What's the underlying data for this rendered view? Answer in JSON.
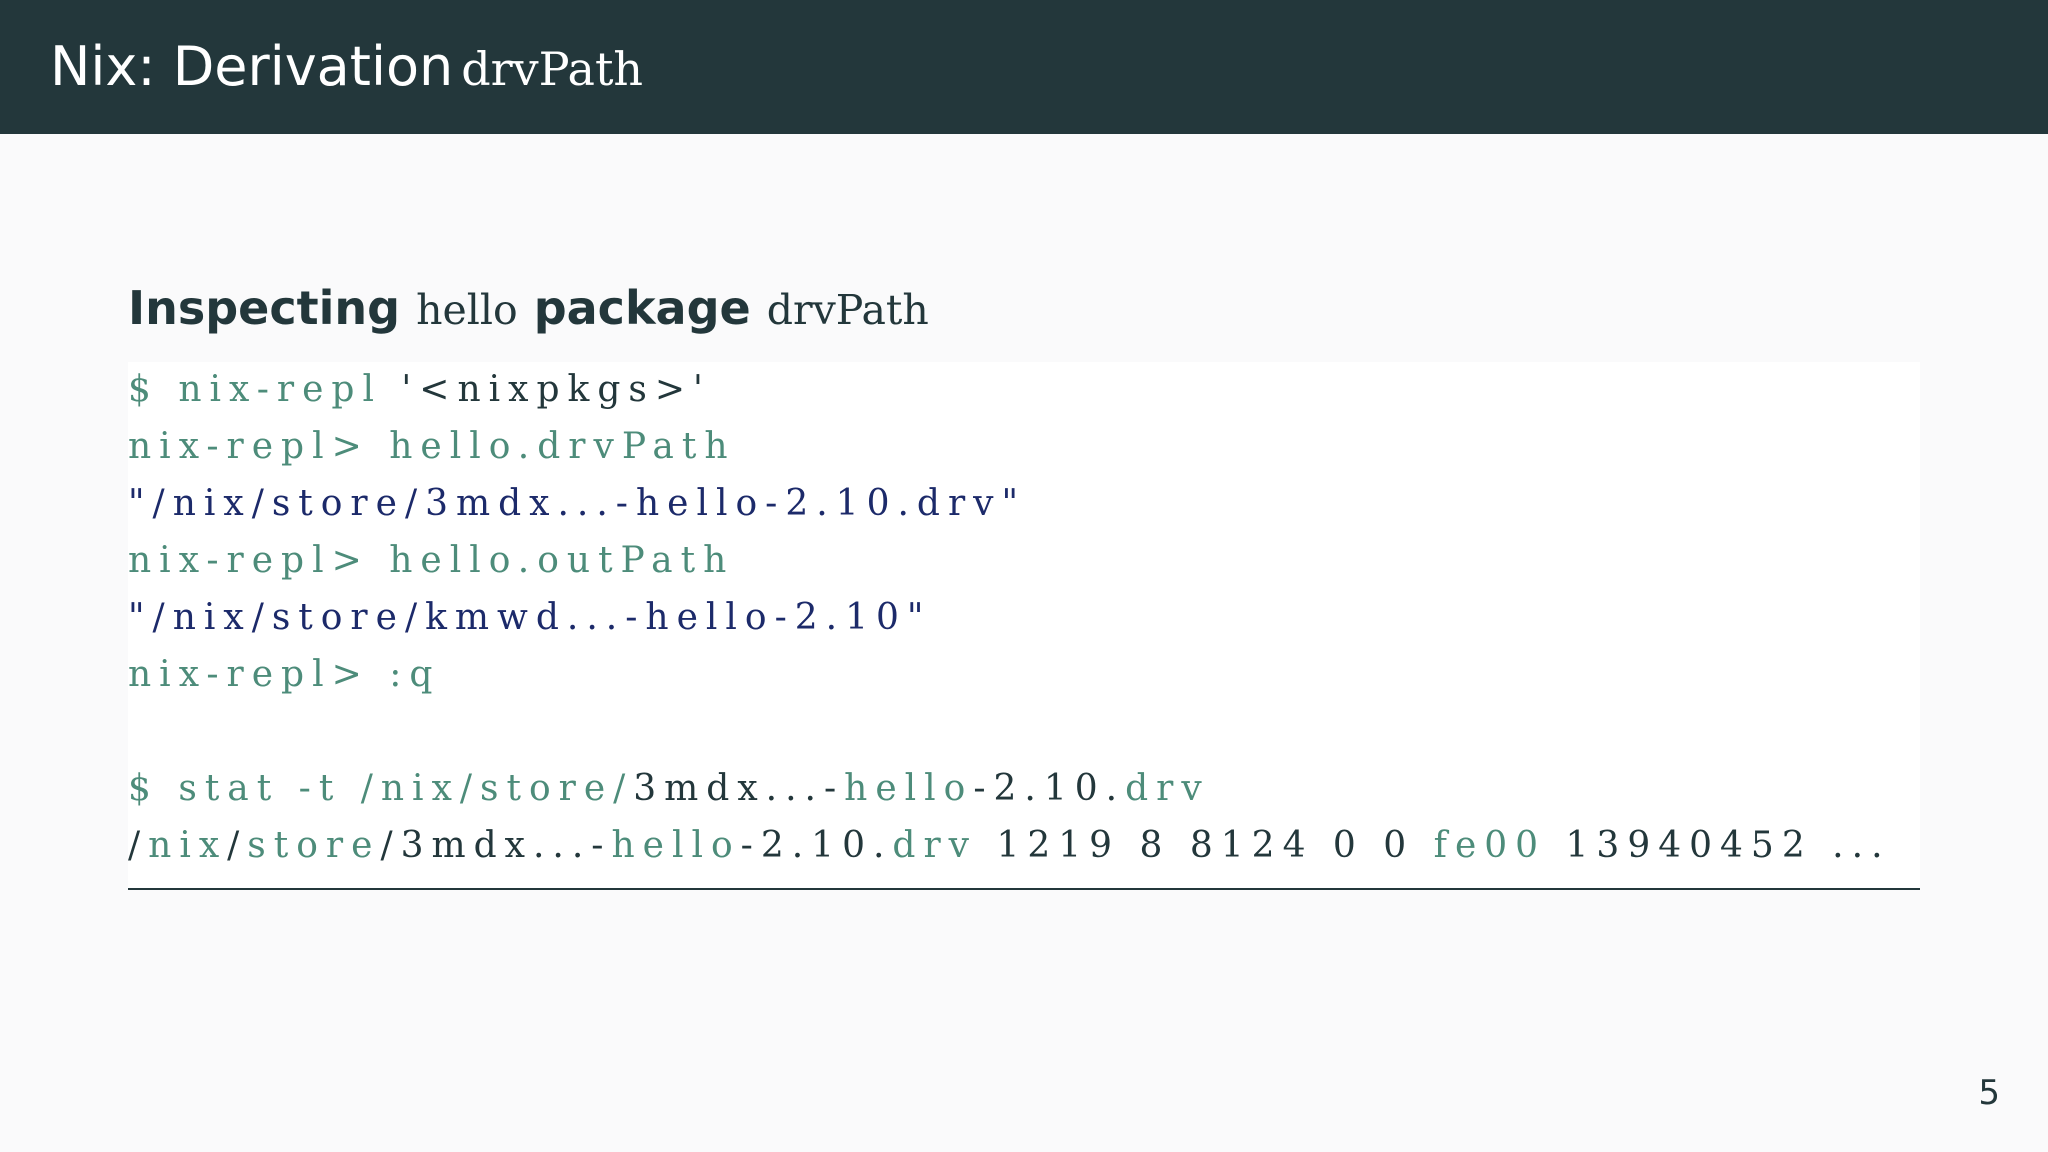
{
  "header": {
    "title_text": "Nix: Derivation",
    "title_code": "drvPath"
  },
  "block": {
    "title_part1": "Inspecting",
    "title_code1": "hello",
    "title_part2": "package",
    "title_code2": "drvPath"
  },
  "code": {
    "line1_prompt": "$ nix-repl",
    "line1_arg": " '<nixpkgs>'",
    "line2_prompt": "nix-repl>",
    "line2_cmd": " hello.drvPath",
    "line3_output": "\"/nix/store/3mdx...-hello-2.10.drv\"",
    "line4_prompt": "nix-repl>",
    "line4_cmd": " hello.outPath",
    "line5_output": "\"/nix/store/kmwd...-hello-2.10\"",
    "line6_prompt": "nix-repl>",
    "line6_cmd": " :q",
    "line8_prompt": "$ stat -t /nix/store/",
    "line8_path_a": "3mdx...-",
    "line8_path_b": "hello",
    "line8_path_c": "-2.10.",
    "line8_path_d": "drv",
    "line9_seg_a": "/",
    "line9_seg_b": "nix",
    "line9_seg_c": "/",
    "line9_seg_d": "store",
    "line9_seg_e": "/3mdx...-",
    "line9_seg_f": "hello",
    "line9_seg_g": "-2.10.",
    "line9_seg_h": "drv",
    "line9_seg_i": " 1219 8 8124 0 0 ",
    "line9_seg_j": "fe00",
    "line9_seg_k": " 13940452 ..."
  },
  "footer": {
    "page_number": "5"
  },
  "colors": {
    "header_bg": "#23373b",
    "prompt_green": "#4d8c7a",
    "output_navy": "#1c2a6a"
  }
}
